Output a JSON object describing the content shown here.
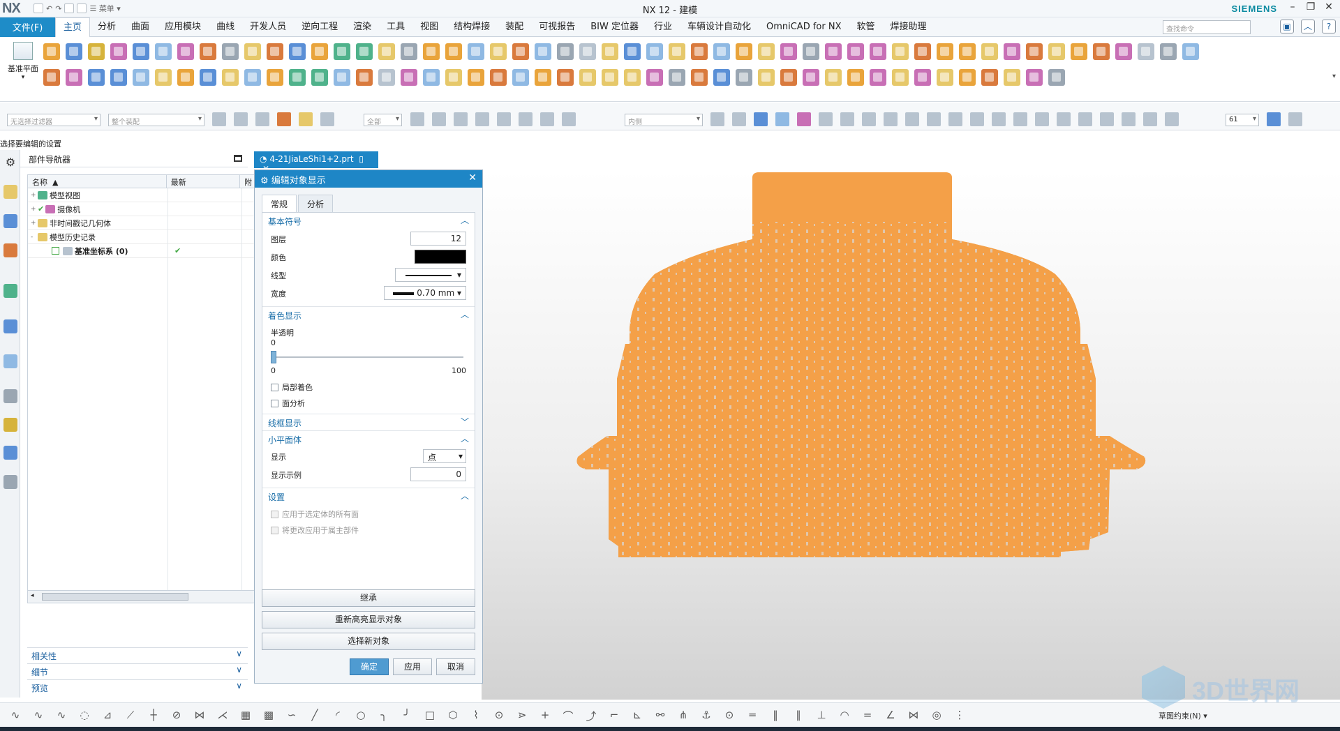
{
  "titlebar": {
    "logo": "NX",
    "menu_label": "菜单",
    "title": "NX 12 - 建模",
    "brand": "SIEMENS",
    "controls": [
      "–",
      "❐",
      "✕"
    ]
  },
  "menubar": {
    "file_label": "文件(F)",
    "tabs": [
      "主页",
      "分析",
      "曲面",
      "应用模块",
      "曲线",
      "开发人员",
      "逆向工程",
      "渲染",
      "工具",
      "视图",
      "结构焊接",
      "装配",
      "可视报告",
      "BIW 定位器",
      "行业",
      "车辆设计自动化",
      "OmniCAD for NX",
      "软管",
      "焊接助理"
    ],
    "active_tab": "主页",
    "search_placeholder": "查找命令"
  },
  "ribbon": {
    "datum_label": "基准平面"
  },
  "toolbar2": {
    "filter_placeholder": "无选择过滤器",
    "assembly_placeholder": "整个装配",
    "scope_placeholder": "全部",
    "inner_placeholder": "内侧",
    "zoom_value": "61"
  },
  "status_prompt": "选择要编辑的设置",
  "navigator": {
    "title": "部件导航器",
    "col_name": "名称",
    "col_latest": "最新",
    "col_extra": "附",
    "rows": [
      {
        "label": "模型视图",
        "exp": "+"
      },
      {
        "label": "摄像机",
        "exp": "+"
      },
      {
        "label": "非时间戳记几何体",
        "exp": "+"
      },
      {
        "label": "模型历史记录",
        "exp": "-"
      },
      {
        "label": "基准坐标系 (0)",
        "exp": "",
        "latest": "✔"
      }
    ],
    "sections": [
      "相关性",
      "细节",
      "预览"
    ]
  },
  "file_tab": {
    "name": "4-21JiaLeShi1+2.prt"
  },
  "dialog": {
    "title": "编辑对象显示",
    "tabs": [
      "常规",
      "分析"
    ],
    "sec_basic": "基本符号",
    "layer_label": "图层",
    "layer_value": "12",
    "color_label": "颜色",
    "color_value": "#000000",
    "linetype_label": "线型",
    "width_label": "宽度",
    "width_value": "0.70 mm",
    "sec_shading": "着色显示",
    "transparency_label": "半透明",
    "transparency_value": "0",
    "slider_min": "0",
    "slider_max": "100",
    "partial_shading_label": "局部着色",
    "face_analysis_label": "面分析",
    "sec_wireframe": "线框显示",
    "sec_facets": "小平面体",
    "display_label": "显示",
    "display_value": "点",
    "display_example_label": "显示示例",
    "display_example_value": "0",
    "sec_settings": "设置",
    "apply_all_faces_label": "应用于选定体的所有面",
    "apply_owner_label": "将更改应用于属主部件",
    "inherit_label": "继承",
    "reselect_label": "重新高亮显示对象",
    "select_new_label": "选择新对象",
    "ok_label": "确定",
    "apply_label": "应用",
    "cancel_label": "取消"
  },
  "viewport": {
    "model_color": "#f4a048"
  },
  "bottombar": {
    "snap_label": "草图约束(N)"
  },
  "watermark": {
    "text": "3D世界网"
  }
}
